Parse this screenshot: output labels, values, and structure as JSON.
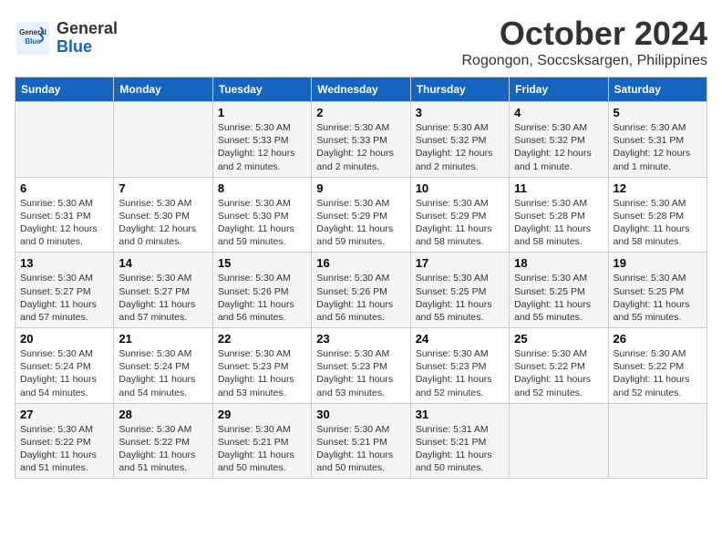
{
  "logo": {
    "line1": "General",
    "line2": "Blue"
  },
  "title": "October 2024",
  "location": "Rogongon, Soccsksargen, Philippines",
  "weekdays": [
    "Sunday",
    "Monday",
    "Tuesday",
    "Wednesday",
    "Thursday",
    "Friday",
    "Saturday"
  ],
  "weeks": [
    [
      {
        "day": "",
        "info": ""
      },
      {
        "day": "",
        "info": ""
      },
      {
        "day": "1",
        "info": "Sunrise: 5:30 AM\nSunset: 5:33 PM\nDaylight: 12 hours\nand 2 minutes."
      },
      {
        "day": "2",
        "info": "Sunrise: 5:30 AM\nSunset: 5:33 PM\nDaylight: 12 hours\nand 2 minutes."
      },
      {
        "day": "3",
        "info": "Sunrise: 5:30 AM\nSunset: 5:32 PM\nDaylight: 12 hours\nand 2 minutes."
      },
      {
        "day": "4",
        "info": "Sunrise: 5:30 AM\nSunset: 5:32 PM\nDaylight: 12 hours\nand 1 minute."
      },
      {
        "day": "5",
        "info": "Sunrise: 5:30 AM\nSunset: 5:31 PM\nDaylight: 12 hours\nand 1 minute."
      }
    ],
    [
      {
        "day": "6",
        "info": "Sunrise: 5:30 AM\nSunset: 5:31 PM\nDaylight: 12 hours\nand 0 minutes."
      },
      {
        "day": "7",
        "info": "Sunrise: 5:30 AM\nSunset: 5:30 PM\nDaylight: 12 hours\nand 0 minutes."
      },
      {
        "day": "8",
        "info": "Sunrise: 5:30 AM\nSunset: 5:30 PM\nDaylight: 11 hours\nand 59 minutes."
      },
      {
        "day": "9",
        "info": "Sunrise: 5:30 AM\nSunset: 5:29 PM\nDaylight: 11 hours\nand 59 minutes."
      },
      {
        "day": "10",
        "info": "Sunrise: 5:30 AM\nSunset: 5:29 PM\nDaylight: 11 hours\nand 58 minutes."
      },
      {
        "day": "11",
        "info": "Sunrise: 5:30 AM\nSunset: 5:28 PM\nDaylight: 11 hours\nand 58 minutes."
      },
      {
        "day": "12",
        "info": "Sunrise: 5:30 AM\nSunset: 5:28 PM\nDaylight: 11 hours\nand 58 minutes."
      }
    ],
    [
      {
        "day": "13",
        "info": "Sunrise: 5:30 AM\nSunset: 5:27 PM\nDaylight: 11 hours\nand 57 minutes."
      },
      {
        "day": "14",
        "info": "Sunrise: 5:30 AM\nSunset: 5:27 PM\nDaylight: 11 hours\nand 57 minutes."
      },
      {
        "day": "15",
        "info": "Sunrise: 5:30 AM\nSunset: 5:26 PM\nDaylight: 11 hours\nand 56 minutes."
      },
      {
        "day": "16",
        "info": "Sunrise: 5:30 AM\nSunset: 5:26 PM\nDaylight: 11 hours\nand 56 minutes."
      },
      {
        "day": "17",
        "info": "Sunrise: 5:30 AM\nSunset: 5:25 PM\nDaylight: 11 hours\nand 55 minutes."
      },
      {
        "day": "18",
        "info": "Sunrise: 5:30 AM\nSunset: 5:25 PM\nDaylight: 11 hours\nand 55 minutes."
      },
      {
        "day": "19",
        "info": "Sunrise: 5:30 AM\nSunset: 5:25 PM\nDaylight: 11 hours\nand 55 minutes."
      }
    ],
    [
      {
        "day": "20",
        "info": "Sunrise: 5:30 AM\nSunset: 5:24 PM\nDaylight: 11 hours\nand 54 minutes."
      },
      {
        "day": "21",
        "info": "Sunrise: 5:30 AM\nSunset: 5:24 PM\nDaylight: 11 hours\nand 54 minutes."
      },
      {
        "day": "22",
        "info": "Sunrise: 5:30 AM\nSunset: 5:23 PM\nDaylight: 11 hours\nand 53 minutes."
      },
      {
        "day": "23",
        "info": "Sunrise: 5:30 AM\nSunset: 5:23 PM\nDaylight: 11 hours\nand 53 minutes."
      },
      {
        "day": "24",
        "info": "Sunrise: 5:30 AM\nSunset: 5:23 PM\nDaylight: 11 hours\nand 52 minutes."
      },
      {
        "day": "25",
        "info": "Sunrise: 5:30 AM\nSunset: 5:22 PM\nDaylight: 11 hours\nand 52 minutes."
      },
      {
        "day": "26",
        "info": "Sunrise: 5:30 AM\nSunset: 5:22 PM\nDaylight: 11 hours\nand 52 minutes."
      }
    ],
    [
      {
        "day": "27",
        "info": "Sunrise: 5:30 AM\nSunset: 5:22 PM\nDaylight: 11 hours\nand 51 minutes."
      },
      {
        "day": "28",
        "info": "Sunrise: 5:30 AM\nSunset: 5:22 PM\nDaylight: 11 hours\nand 51 minutes."
      },
      {
        "day": "29",
        "info": "Sunrise: 5:30 AM\nSunset: 5:21 PM\nDaylight: 11 hours\nand 50 minutes."
      },
      {
        "day": "30",
        "info": "Sunrise: 5:30 AM\nSunset: 5:21 PM\nDaylight: 11 hours\nand 50 minutes."
      },
      {
        "day": "31",
        "info": "Sunrise: 5:31 AM\nSunset: 5:21 PM\nDaylight: 11 hours\nand 50 minutes."
      },
      {
        "day": "",
        "info": ""
      },
      {
        "day": "",
        "info": ""
      }
    ]
  ]
}
